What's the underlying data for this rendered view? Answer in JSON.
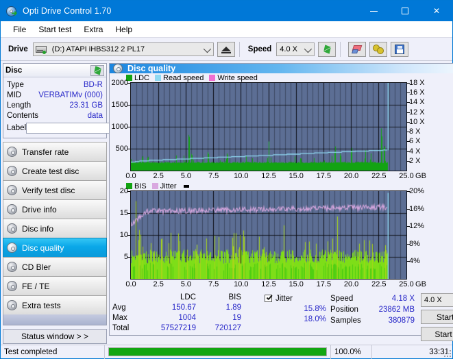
{
  "window": {
    "title": "Opti Drive Control 1.70",
    "icon": "disc-arrow-icon",
    "buttons": {
      "minimize": "—",
      "maximize": "□",
      "close": "✕"
    }
  },
  "menu": {
    "items": [
      "File",
      "Start test",
      "Extra",
      "Help"
    ]
  },
  "toolbar": {
    "drive_label": "Drive",
    "drive_value": "(D:)  ATAPI iHBS312  2 PL17",
    "eject_icon": "eject-icon",
    "speed_label": "Speed",
    "speed_value": "4.0 X",
    "refresh_icon": "refresh-icon",
    "erase_icon": "eraser-icon",
    "gears_icon": "gears-icon",
    "save_icon": "floppy-save-icon"
  },
  "disc_panel": {
    "title": "Disc",
    "refresh_icon": "refresh-icon",
    "rows": [
      {
        "key": "Type",
        "value": "BD-R"
      },
      {
        "key": "MID",
        "value": "VERBATIMv (000)"
      },
      {
        "key": "Length",
        "value": "23.31 GB"
      },
      {
        "key": "Contents",
        "value": "data"
      }
    ],
    "label_key": "Label",
    "label_value": "",
    "label_placeholder": "",
    "disc_button_icon": "cd-disc-icon"
  },
  "nav": {
    "items": [
      {
        "label": "Transfer rate",
        "active": false
      },
      {
        "label": "Create test disc",
        "active": false
      },
      {
        "label": "Verify test disc",
        "active": false
      },
      {
        "label": "Drive info",
        "active": false
      },
      {
        "label": "Disc info",
        "active": false
      },
      {
        "label": "Disc quality",
        "active": true
      },
      {
        "label": "CD Bler",
        "active": false
      },
      {
        "label": "FE / TE",
        "active": false
      },
      {
        "label": "Extra tests",
        "active": false
      }
    ],
    "status_window_button": "Status window > >"
  },
  "content": {
    "title": "Disc quality",
    "icon": "disc-quality-icon"
  },
  "chart_data": [
    {
      "type": "area",
      "id": "ldc-chart",
      "title": "",
      "xlabel": "GB",
      "ylabel": "",
      "xlim": [
        0,
        25
      ],
      "ylim": [
        0,
        2000
      ],
      "y2lim": [
        0,
        18
      ],
      "grid": true,
      "legend_position": "top-left",
      "legend": [
        {
          "name": "LDC",
          "color": "#13a313"
        },
        {
          "name": "Read speed",
          "color": "#8fd9f2"
        },
        {
          "name": "Write speed",
          "color": "#f06fd0"
        }
      ],
      "xticks": [
        "0.0",
        "2.5",
        "5.0",
        "7.5",
        "10.0",
        "12.5",
        "15.0",
        "17.5",
        "20.0",
        "22.5",
        "25.0"
      ],
      "yticks": [
        "2000",
        "1500",
        "1000",
        "500"
      ],
      "y2ticks": [
        "18 X",
        "16 X",
        "14 X",
        "12 X",
        "10 X",
        "8 X",
        "6 X",
        "4 X",
        "2 X"
      ],
      "xunit": "GB",
      "data_end_gb": 23.31,
      "series": [
        {
          "name": "LDC",
          "color": "#13a313",
          "x": [
            0.0,
            0.25,
            0.5,
            0.75,
            1.0,
            1.25,
            1.5,
            1.75,
            2.0,
            2.25,
            2.5,
            2.75,
            3.0,
            3.25,
            3.5,
            3.75,
            4.0,
            4.25,
            4.5,
            4.75,
            5.0,
            5.25,
            5.5,
            5.75,
            6.0,
            6.25,
            6.5,
            6.75,
            7.0,
            7.25,
            7.5,
            7.75,
            8.0,
            8.25,
            8.5,
            8.75,
            9.0,
            9.25,
            9.5,
            9.75,
            10.0,
            10.25,
            10.5,
            10.75,
            11.0,
            11.25,
            11.5,
            11.75,
            12.0,
            12.25,
            12.5,
            12.75,
            13.0,
            13.25,
            13.5,
            13.75,
            14.0,
            14.25,
            14.5,
            14.75,
            15.0,
            15.25,
            15.5,
            15.75,
            16.0,
            16.25,
            16.5,
            16.75,
            17.0,
            17.25,
            17.5,
            17.75,
            18.0,
            18.25,
            18.5,
            18.75,
            19.0,
            19.25,
            19.5,
            19.75,
            20.0,
            20.25,
            20.5,
            20.75,
            21.0,
            21.25,
            21.5,
            21.75,
            22.0,
            22.25,
            22.5,
            22.75,
            23.0,
            23.25
          ],
          "y": [
            120,
            190,
            330,
            260,
            420,
            240,
            350,
            300,
            180,
            200,
            170,
            200,
            190,
            210,
            180,
            200,
            230,
            200,
            210,
            250,
            190,
            930,
            420,
            210,
            200,
            200,
            230,
            200,
            480,
            220,
            200,
            200,
            190,
            210,
            200,
            420,
            200,
            220,
            210,
            200,
            200,
            260,
            190,
            210,
            200,
            200,
            240,
            200,
            210,
            190,
            740,
            200,
            230,
            210,
            200,
            260,
            200,
            220,
            200,
            210,
            250,
            200,
            210,
            200,
            230,
            200,
            210,
            240,
            200,
            220,
            200,
            210,
            230,
            200,
            560,
            280,
            420,
            200,
            230,
            210,
            600,
            210,
            230,
            250,
            220,
            560,
            210,
            420,
            250,
            300,
            220,
            1004,
            560,
            300
          ]
        },
        {
          "name": "Read speed",
          "color": "#8fd9f2",
          "unit": "X",
          "x": [
            0.0,
            1.0,
            2.0,
            3.0,
            4.0,
            5.0,
            6.0,
            7.0,
            8.0,
            9.0,
            10.0,
            11.0,
            12.0,
            13.0,
            14.0,
            15.0,
            16.0,
            17.0,
            18.0,
            19.0,
            20.0,
            21.0,
            22.0,
            23.0,
            23.3,
            23.35
          ],
          "y": [
            1.7,
            2.0,
            2.1,
            2.2,
            2.3,
            2.4,
            2.5,
            2.6,
            2.7,
            2.8,
            2.9,
            3.0,
            3.1,
            3.2,
            3.3,
            3.4,
            3.5,
            3.6,
            3.7,
            3.8,
            3.9,
            4.0,
            4.1,
            4.2,
            4.2,
            18.0
          ]
        }
      ]
    },
    {
      "type": "area",
      "id": "bis-jitter-chart",
      "title": "",
      "xlabel": "GB",
      "xlim": [
        0,
        25
      ],
      "ylim": [
        0,
        20
      ],
      "y2lim": [
        0,
        20
      ],
      "grid": true,
      "legend_position": "top-left",
      "legend": [
        {
          "name": "BIS",
          "color": "#13a313"
        },
        {
          "name": "Jitter",
          "color": "#d9a8e0"
        }
      ],
      "xticks": [
        "0.0",
        "2.5",
        "5.0",
        "7.5",
        "10.0",
        "12.5",
        "15.0",
        "17.5",
        "20.0",
        "22.5",
        "25.0"
      ],
      "yticks": [
        "20",
        "15",
        "10",
        "5"
      ],
      "y2ticks": [
        "20%",
        "16%",
        "12%",
        "8%",
        "4%"
      ],
      "xunit": "GB",
      "data_end_gb": 23.31,
      "series": [
        {
          "name": "BIS",
          "color": "#7ede18",
          "avg": 1.89,
          "max": 19,
          "total": 720127
        },
        {
          "name": "Jitter",
          "color": "#d9a8e0",
          "avg": "15.8%",
          "max": "18.0%"
        }
      ]
    }
  ],
  "stats": {
    "col_headers": [
      "LDC",
      "BIS"
    ],
    "row_labels": [
      "Avg",
      "Max",
      "Total"
    ],
    "ldc": {
      "avg": "150.67",
      "max": "1004",
      "total": "57527219"
    },
    "bis": {
      "avg": "1.89",
      "max": "19",
      "total": "720127"
    },
    "jitter": {
      "label": "Jitter",
      "checked": true,
      "avg": "15.8%",
      "max": "18.0%"
    },
    "speed": {
      "label": "Speed",
      "value": "4.18 X"
    },
    "position": {
      "label": "Position",
      "value": "23862 MB"
    },
    "samples": {
      "label": "Samples",
      "value": "380879"
    },
    "speed_select": "4.0 X",
    "start_full_button": "Start full",
    "start_part_button": "Start part"
  },
  "statusbar": {
    "message": "Test completed",
    "progress_percent": 100.0,
    "progress_label": "100.0%",
    "elapsed": "33:31"
  },
  "colors": {
    "accent": "#0078d7",
    "plot_bg": "#5c6e94",
    "ldc_green": "#13a313",
    "bis_green": "#7ede18",
    "jitter_pink": "#d9a8e0",
    "read_speed": "#8fd9f2",
    "write_speed": "#f06fd0",
    "value_blue": "#2727c8",
    "progress_green": "#12a612"
  }
}
